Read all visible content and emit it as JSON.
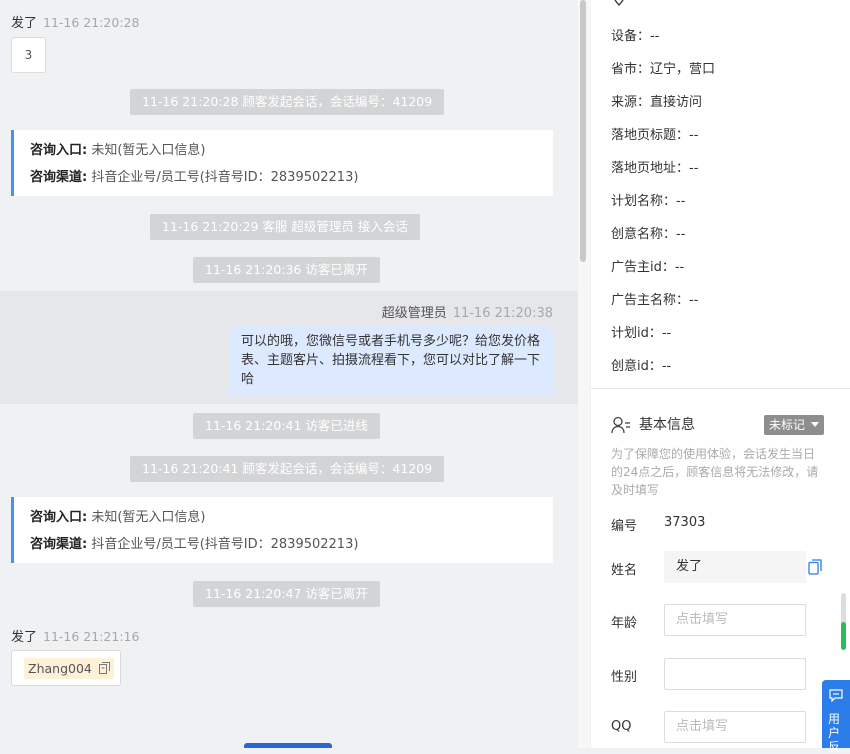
{
  "chat": {
    "msg1": {
      "sender": "发了",
      "time": "11-16 21:20:28",
      "content": "3"
    },
    "sys1": "11-16 21:20:28 顾客发起会话，会话编号：41209",
    "card1": {
      "entry_label": "咨询入口:",
      "entry_value": "未知(暂无入口信息)",
      "channel_label": "咨询渠道:",
      "channel_value": "抖音企业号/员工号(抖音号ID：2839502213)"
    },
    "sys2": "11-16 21:20:29 客服 超级管理员 接入会话",
    "sys3": "11-16 21:20:36 访客已离开",
    "agent_msg": {
      "sender": "超级管理员",
      "time": "11-16 21:20:38",
      "content": "可以的哦，您微信号或者手机号多少呢？给您发价格表、主题客片、拍摄流程看下，您可以对比了解一下哈"
    },
    "sys4": "11-16 21:20:41 访客已进线",
    "sys5": "11-16 21:20:41 顾客发起会话，会话编号：41209",
    "card2": {
      "entry_label": "咨询入口:",
      "entry_value": "未知(暂无入口信息)",
      "channel_label": "咨询渠道:",
      "channel_value": "抖音企业号/员工号(抖音号ID：2839502213)"
    },
    "sys6": "11-16 21:20:47 访客已离开",
    "msg2": {
      "sender": "发了",
      "time": "11-16 21:21:16",
      "content": "Zhang004"
    }
  },
  "source_info": {
    "device": "设备：--",
    "province": "省市：辽宁，营口",
    "source": "来源：直接访问",
    "landing_title": "落地页标题：--",
    "landing_url": "落地页地址：--",
    "plan_name": "计划名称：--",
    "creative_name": "创意名称：--",
    "advertiser_id": "广告主id：--",
    "advertiser_name": "广告主名称：--",
    "plan_id": "计划id：--",
    "creative_id": "创意id：--"
  },
  "basic_info": {
    "title": "基本信息",
    "mark_label": "未标记",
    "notice": "为了保障您的使用体验，会话发生当日的24点之后，顾客信息将无法修改，请及时填写",
    "id_label": "编号",
    "id_value": "37303",
    "name_label": "姓名",
    "name_value": "发了",
    "age_label": "年龄",
    "age_placeholder": "点击填写",
    "gender_label": "性别",
    "qq_label": "QQ",
    "qq_placeholder": "点击填写"
  },
  "feedback": {
    "label": "用户反"
  },
  "icons": [
    "location-icon",
    "user-icon",
    "caret-down-icon",
    "copy-icon",
    "feedback-icon"
  ],
  "colors": {
    "accent": "#4b8ff0",
    "agent_bubble": "#dde9ff",
    "system_pill": "#d3d4d6",
    "tag_bg": "#fdf2d8",
    "feedback_button": "#2b7de9"
  }
}
